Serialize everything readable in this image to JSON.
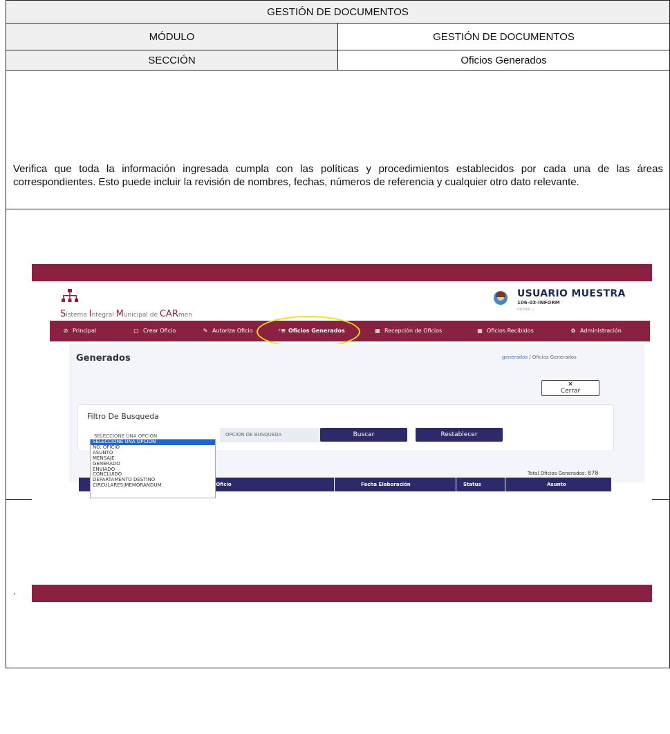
{
  "header": {
    "title": "GESTIÓN DE DOCUMENTOS",
    "modulo_label": "MÓDULO",
    "modulo_value": "GESTIÓN DE DOCUMENTOS",
    "seccion_label": "SECCIÓN",
    "seccion_value": "Oficios Generados"
  },
  "description": "Verifica que toda la información ingresada cumpla con las políticas y procedimientos establecidos por cada una de las áreas correspondientes. Esto puede incluir la revisión de nombres, fechas, números de referencia y cualquier otro dato relevante.",
  "screenshot": {
    "logo": {
      "s": "S",
      "istema": "istema ",
      "i": "I",
      "ntegral": "ntegral ",
      "m": "M",
      "unicipal_de": "unicipal de ",
      "car": "CAR",
      "men": "men"
    },
    "user": {
      "name": "USUARIO MUESTRA",
      "code": "106-03-INFORM",
      "status": "online ⌄"
    },
    "nav": [
      {
        "icon": "⊘",
        "label": "Principal"
      },
      {
        "icon": "▢",
        "label": "Crear Oficio"
      },
      {
        "icon": "✎",
        "label": "Autoriza Oficio"
      },
      {
        "icon": "⁺≡",
        "label": "Oficios Generados"
      },
      {
        "icon": "▦",
        "label": "Recepción de Oficios"
      },
      {
        "icon": "▦",
        "label": "Oficios Recibidos"
      },
      {
        "icon": "✿",
        "label": "Administración"
      }
    ],
    "page_title": "Generados",
    "breadcrumb": {
      "link": "generados",
      "sep": " / ",
      "current": "Oficios Generados"
    },
    "close_icon": "×",
    "close_label": "Cerrar",
    "filter_title": "Filtro De Busqueda",
    "select_value": "SELECCIONE UNA OPCION",
    "search_placeholder": "OPCION DE BUSQUEDA",
    "search_button": "Buscar",
    "reset_button": "Restablecer",
    "dropdown_options": [
      "SELECCIONE UNA OPCION",
      "NO. OFICIO",
      "ASUNTO",
      "MENSAJE",
      "GENERADO",
      "ENVIADO",
      "CONCLUIDO",
      "DEPARTAMENTO DESTINO",
      "CIRCULARES|MEMORÁNDUM"
    ],
    "total_label": "Total Oficios Generados: ",
    "total_value": "878",
    "table_headers": [
      "Num. Oficio",
      "Fecha Elaboración",
      "Status",
      "Asunto"
    ],
    "accent_color": "#8a2140",
    "button_color": "#2c2a6b"
  },
  "footer_text": "."
}
